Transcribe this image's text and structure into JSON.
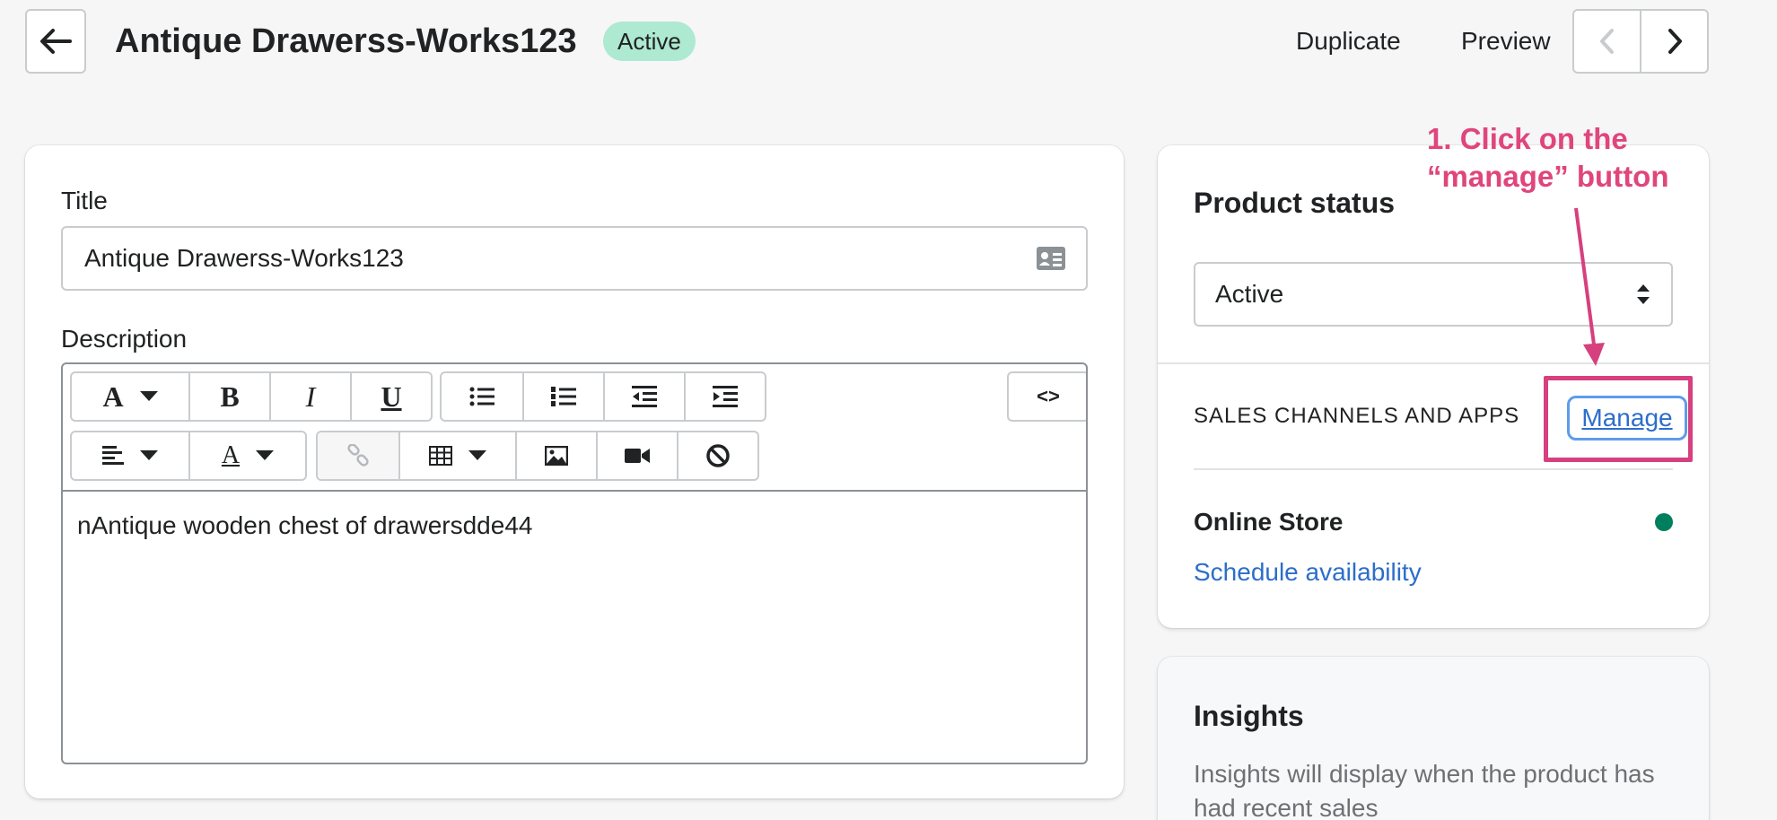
{
  "header": {
    "title": "Antique Drawerss-Works123",
    "status_badge": "Active",
    "duplicate_label": "Duplicate",
    "preview_label": "Preview"
  },
  "main": {
    "title_label": "Title",
    "title_value": "Antique Drawerss-Works123",
    "description_label": "Description",
    "description_value": "nAntique wooden chest of drawersdde44",
    "toolbar": {
      "font_glyph": "A",
      "bold_glyph": "B",
      "italic_glyph": "I",
      "underline_glyph": "U",
      "color_glyph": "A",
      "html_glyph": "<>"
    }
  },
  "status_card": {
    "heading": "Product status",
    "selected_status": "Active",
    "channels_label": "SALES CHANNELS AND APPS",
    "manage_label": "Manage",
    "channel_name": "Online Store",
    "schedule_link": "Schedule availability"
  },
  "insights_card": {
    "heading": "Insights",
    "text": "Insights will display when the product has had recent sales"
  },
  "annotation": {
    "text": "1. Click on the “manage” button"
  },
  "colors": {
    "accent_link": "#2c6ecb",
    "status_green": "#007f5f",
    "badge_bg": "#aee9d1",
    "annotation_pink": "#e0457b"
  },
  "icons": {
    "back": "arrow-left-icon",
    "prev": "chevron-left-icon",
    "next": "chevron-right-icon",
    "title_field": "contact-card-icon",
    "select": "select-arrows-icon"
  }
}
